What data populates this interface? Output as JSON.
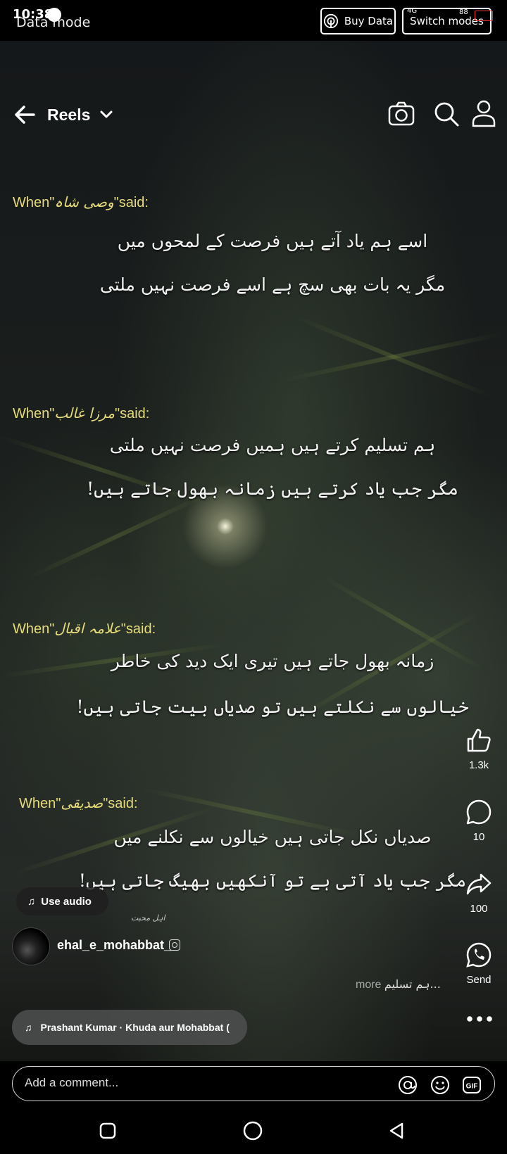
{
  "status_bar": {
    "time": "10:38",
    "mode_label": "Data mode",
    "buy_data_label": "Buy Data",
    "switch_modes_label": "Switch modes",
    "network": "4G",
    "battery": "88"
  },
  "header": {
    "title": "Reels"
  },
  "overlay": {
    "when_prefix": "When\"",
    "said_suffix": "\"said:",
    "quotes": [
      {
        "poet": "وصی شاہ",
        "line1": "اسے ہم یاد آتے ہیں فرصت کے لمحوں میں",
        "line2": "مگر یہ بات بھی سچ ہے اسے فرصت نہیں ملتی"
      },
      {
        "poet": "مرزا غالب",
        "line1": "ہم تسلیم کرتے ہیں ہمیں فرصت نہیں ملتی",
        "line2": "مگر جب یاد کرتے ہیں زمانہ بھول جاتے ہیں!"
      },
      {
        "poet": "علامہ اقبال",
        "line1": "زمانہ بھول جاتے ہیں تیری ایک دید کی خاطر",
        "line2": "خیالوں سے نکلتے ہیں تو صدیاں بیت جاتی ہیں!"
      },
      {
        "poet": "صدیقی",
        "line1": "صدیاں نکل جاتی ہیں خیالوں سے نکلنے میں",
        "line2": "مگر جب یاد آتی ہے تو آنکھیں بھیگ جاتی ہیں!"
      }
    ],
    "signature": "اہل محبت"
  },
  "actions": {
    "likes": "1.3k",
    "comments": "10",
    "shares": "100",
    "send_label": "Send"
  },
  "reel": {
    "use_audio_label": "Use audio",
    "username": "ehal_e_mohabbat_",
    "caption_urdu": "ہم تسلیم...",
    "caption_more": "more",
    "music_text": "Prashant Kumar · Khuda aur Mohabbat ("
  },
  "comment_bar": {
    "placeholder": "Add a comment..."
  }
}
